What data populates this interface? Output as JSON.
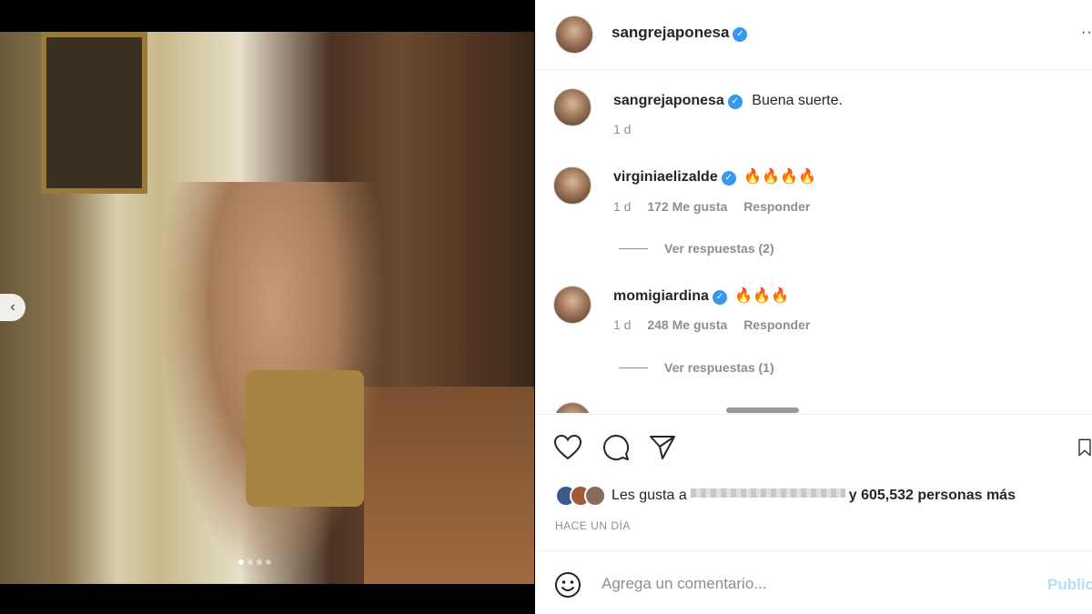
{
  "media": {
    "carousel_prev_glyph": "‹",
    "dots_count": 4,
    "active_dot": 0
  },
  "header": {
    "username": "sangrejaponesa",
    "more_glyph": "···"
  },
  "comments": [
    {
      "username": "sangrejaponesa",
      "text": "Buena suerte.",
      "time": "1 d",
      "likes": "",
      "reply": ""
    },
    {
      "username": "virginiaelizalde",
      "text": "🔥🔥🔥🔥",
      "time": "1 d",
      "likes": "172 Me gusta",
      "reply": "Responder",
      "view_replies": "Ver respuestas (2)"
    },
    {
      "username": "momigiardina",
      "text": "🔥🔥🔥",
      "time": "1 d",
      "likes": "248 Me gusta",
      "reply": "Responder",
      "view_replies": "Ver respuestas (1)"
    }
  ],
  "actions": {
    "like_icon": "heart-icon",
    "comment_icon": "comment-icon",
    "share_icon": "share-icon",
    "save_icon": "bookmark-icon"
  },
  "likes": {
    "prefix": "Les gusta a",
    "suffix": "y 605,532 personas más"
  },
  "time_ago": "HACE UN DÍA",
  "comment_box": {
    "placeholder": "Agrega un comentario...",
    "post_label": "Publicar"
  },
  "colors": {
    "verified": "#3897f0",
    "post_button": "#b2dffc",
    "muted": "#8e8e8e"
  }
}
